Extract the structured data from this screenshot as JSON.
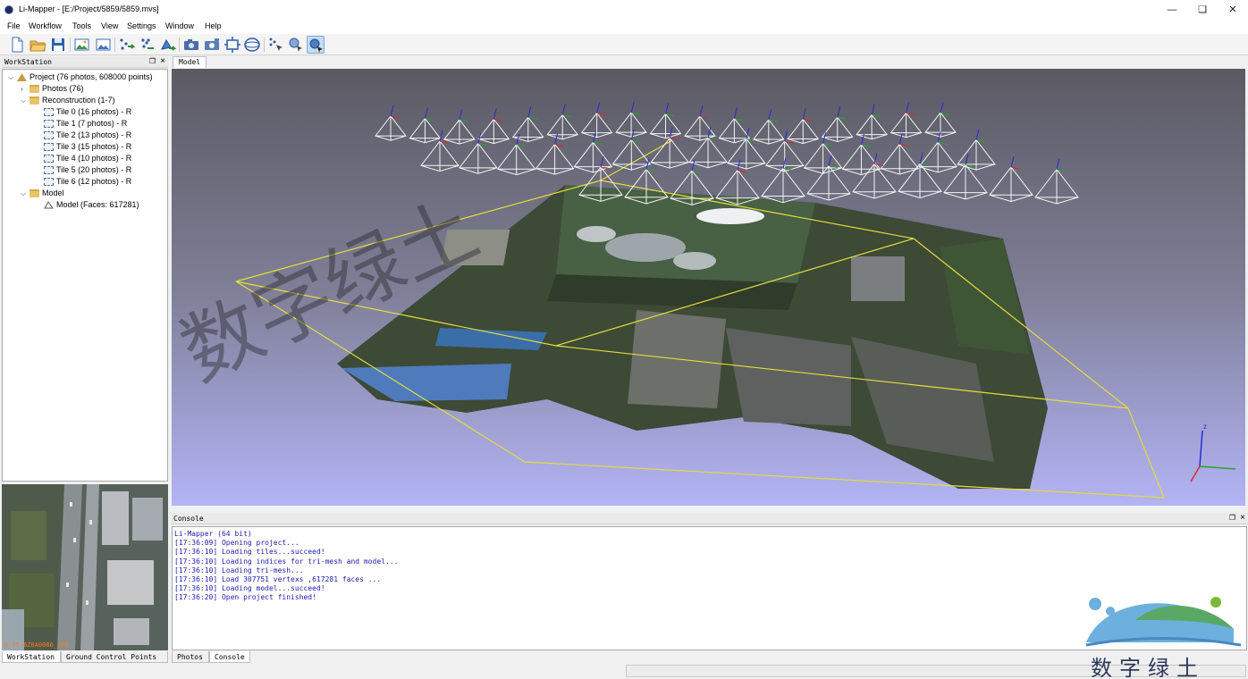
{
  "window": {
    "title": "Li-Mapper - [E:/Project/5859/5859.mvs]",
    "controls": {
      "minimize": "—",
      "restore": "❏",
      "close": "✕"
    }
  },
  "menu": [
    "File",
    "Workflow",
    "Tools",
    "View",
    "Settings",
    "Window",
    "Help"
  ],
  "toolbar": {
    "icons": [
      "new-project-icon",
      "open-project-icon",
      "save-icon",
      "add-photos-icon",
      "add-photo-folder-icon",
      "align-photos-icon",
      "build-dense-cloud-icon",
      "build-mesh-icon",
      "camera-icon",
      "camera-group-icon",
      "fit-view-icon",
      "rotate-view-icon",
      "point-select-icon",
      "region-select-icon",
      "texture-icon"
    ],
    "active_icon": "texture-icon"
  },
  "workstation": {
    "title": "WorkStation",
    "tree": [
      {
        "label": "Project (76 photos, 608000 points)",
        "level": 0,
        "expanded": true,
        "icon": "project-icon"
      },
      {
        "label": "Photos (76)",
        "level": 1,
        "expanded": false,
        "icon": "folder-icon"
      },
      {
        "label": "Reconstruction (1-7)",
        "level": 1,
        "expanded": true,
        "icon": "folder-icon"
      },
      {
        "label": "Tile 0 (16 photos) - R",
        "level": 2,
        "icon": "tile-icon"
      },
      {
        "label": "Tile 1 (7 photos) - R",
        "level": 2,
        "icon": "tile-icon"
      },
      {
        "label": "Tile 2 (13 photos) - R",
        "level": 2,
        "icon": "tile-icon"
      },
      {
        "label": "Tile 3 (15 photos) - R",
        "level": 2,
        "icon": "tile-icon"
      },
      {
        "label": "Tile 4 (10 photos) - R",
        "level": 2,
        "icon": "tile-icon"
      },
      {
        "label": "Tile 5 (20 photos) - R",
        "level": 2,
        "icon": "tile-icon"
      },
      {
        "label": "Tile 6 (12 photos) - R",
        "level": 2,
        "icon": "tile-icon"
      },
      {
        "label": "Model",
        "level": 1,
        "expanded": true,
        "icon": "folder-icon"
      },
      {
        "label": "Model (Faces: 617281)",
        "level": 2,
        "icon": "mesh-icon"
      }
    ],
    "thumbnail_caption": "0-75-6Z0A0086_JPG"
  },
  "left_tabs": [
    "WorkStation",
    "Ground Control Points"
  ],
  "model_tab": "Model",
  "viewport": {
    "overlay_text": "数字绿土",
    "axis_label": "z",
    "background_top": "#5b5a63",
    "background_bottom": "#b3b4f5",
    "bbox_color": "#e5dc3a"
  },
  "console": {
    "title": "Console",
    "lines": [
      "Li-Mapper (64 bit)",
      "[17:36:09] Opening project...",
      "[17:36:10] Loading tiles...succeed!",
      "[17:36:10] Loading indices for tri-mesh and model...",
      "[17:36:10] Loading tri-mesh...",
      "[17:36:10] Load 307751 vertexs ,617281 faces ...",
      "[17:36:10] Loading model...succeed!",
      "[17:36:20] Open project finished!"
    ],
    "text_color": "#1c1cab"
  },
  "bottom_tabs": [
    "Photos",
    "Console"
  ],
  "brand": {
    "text": "数字绿土"
  }
}
